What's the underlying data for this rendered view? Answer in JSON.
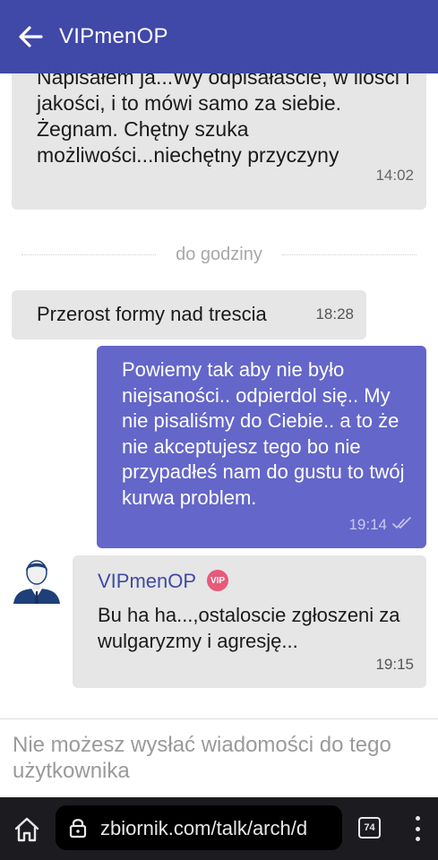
{
  "header": {
    "title": "VIPmenOP",
    "back_icon": "arrow-left-icon",
    "background": "#4048a8"
  },
  "messages": [
    {
      "direction": "incoming",
      "text": "Napisałem ja...Wy odpisałaście, w ilości i jakości, i to mówi samo za siebie. Żegnam. Chętny szuka możliwości...niechętny przyczyny",
      "time": "14:02"
    },
    {
      "direction": "incoming",
      "text": "Przerost formy nad trescia",
      "time": "18:28"
    },
    {
      "direction": "outgoing",
      "text": "Powiemy tak aby nie było niejsaności.. odpierdol się.. My nie pisaliśmy do Ciebie.. a to że nie akceptujesz tego bo nie przypadłeś nam do gustu to twój kurwa problem.",
      "time": "19:14",
      "status_icon": "double-check-icon"
    },
    {
      "direction": "incoming",
      "author": "VIPmenOP",
      "badge": "VIP",
      "text": "Bu ha ha...,ostaloscie zgłoszeni za wulgaryzmy i agresję...",
      "time": "19:15"
    }
  ],
  "divider": {
    "label": "do godziny"
  },
  "composer": {
    "notice": "Nie możesz wysłać wiadomości do tego użytkownika"
  },
  "browser": {
    "url": "zbiornik.com/talk/arch/d",
    "tab_count": "74",
    "home_icon": "home-icon",
    "lock_icon": "lock-icon",
    "menu_icon": "more-vert-icon"
  },
  "colors": {
    "outgoing_bubble": "#6466c9",
    "incoming_bubble": "#e6e6e6",
    "author_name": "#3f4aa3",
    "vip_badge": "#e65a7a"
  }
}
